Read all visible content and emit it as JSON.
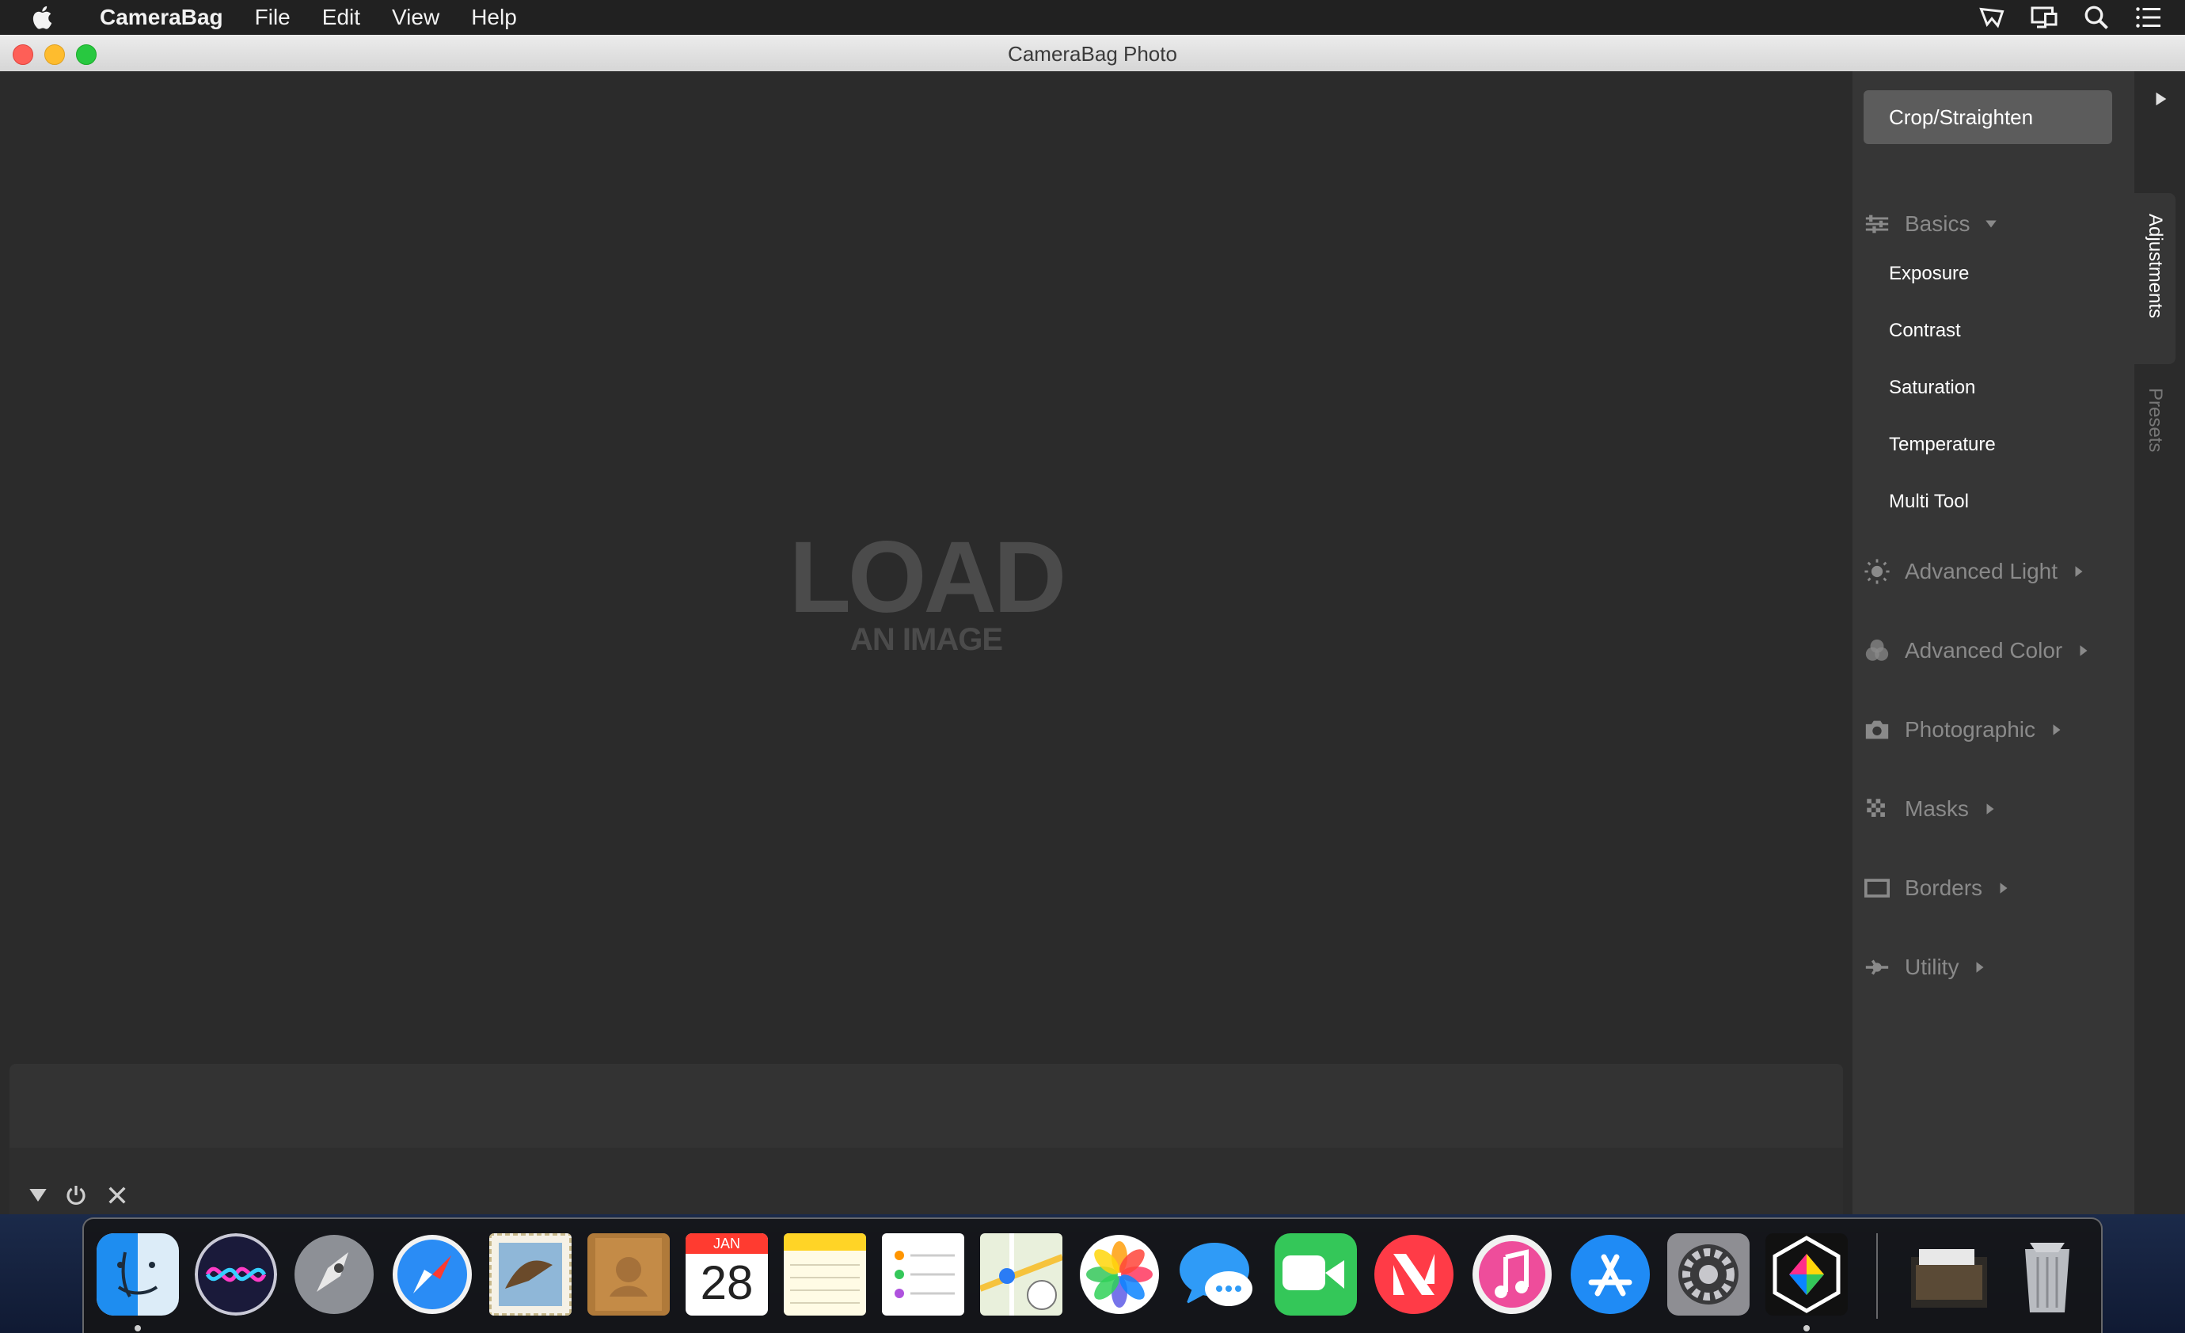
{
  "menubar": {
    "app_name": "CameraBag",
    "menus": [
      "File",
      "Edit",
      "View",
      "Help"
    ],
    "status_icons": [
      "airplay-icon",
      "display-icon",
      "spotlight-search-icon",
      "notification-list-icon"
    ]
  },
  "window": {
    "title": "CameraBag Photo"
  },
  "canvas": {
    "load_big": "LOAD",
    "load_small": "AN IMAGE"
  },
  "filmstrip": {
    "controls": [
      "collapse-triangle-icon",
      "power-icon",
      "close-x-icon"
    ]
  },
  "panel": {
    "crop_label": "Crop/Straighten",
    "sections": [
      {
        "label": "Basics",
        "icon": "sliders-icon",
        "expanded": true
      },
      {
        "label": "Advanced Light",
        "icon": "sun-icon",
        "expanded": false
      },
      {
        "label": "Advanced Color",
        "icon": "color-circles-icon",
        "expanded": false
      },
      {
        "label": "Photographic",
        "icon": "camera-icon",
        "expanded": false
      },
      {
        "label": "Masks",
        "icon": "mask-checker-icon",
        "expanded": false
      },
      {
        "label": "Borders",
        "icon": "border-rect-icon",
        "expanded": false
      },
      {
        "label": "Utility",
        "icon": "utility-icon",
        "expanded": false
      }
    ],
    "basics_items": [
      "Exposure",
      "Contrast",
      "Saturation",
      "Temperature",
      "Multi Tool"
    ]
  },
  "tabs": {
    "active": "Adjustments",
    "inactive": "Presets"
  },
  "dock": {
    "apps": [
      "Finder",
      "Siri",
      "Launchpad",
      "Safari",
      "Mail",
      "Contacts",
      "Calendar",
      "Notes",
      "Reminders",
      "Maps",
      "Photos",
      "Messages",
      "FaceTime",
      "News",
      "iTunes",
      "App Store",
      "System Preferences",
      "CameraBag"
    ],
    "calendar_month": "JAN",
    "calendar_day": "28",
    "extras": [
      "Downloads",
      "Trash"
    ]
  }
}
